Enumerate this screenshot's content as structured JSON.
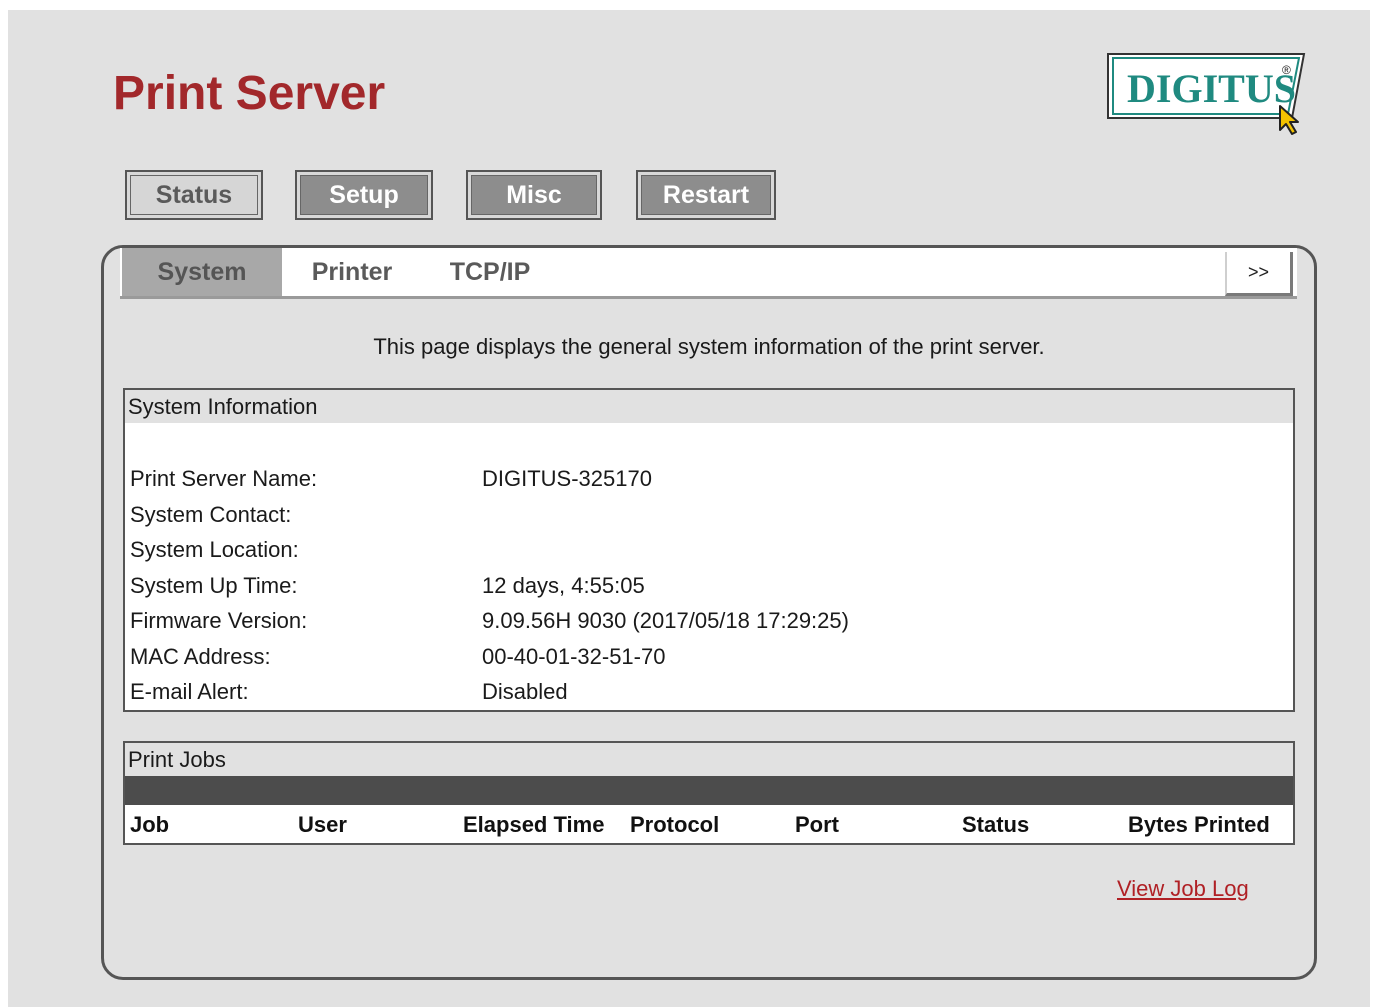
{
  "header": {
    "title": "Print Server",
    "logo_text": "DIGITUS",
    "logo_mark": "®",
    "brand_color": "#a2282b",
    "logo_color": "#1f8a80"
  },
  "main_tabs": [
    {
      "label": "Status",
      "active": true
    },
    {
      "label": "Setup",
      "active": false
    },
    {
      "label": "Misc",
      "active": false
    },
    {
      "label": "Restart",
      "active": false
    }
  ],
  "sub_tabs": [
    {
      "label": "System",
      "active": true
    },
    {
      "label": "Printer",
      "active": false
    },
    {
      "label": "TCP/IP",
      "active": false
    }
  ],
  "more_button": ">>",
  "description": "This page displays the general system information of the print server.",
  "system_info": {
    "header": "System Information",
    "rows": [
      {
        "label": "Print Server Name:",
        "value": "DIGITUS-325170"
      },
      {
        "label": "System Contact:",
        "value": ""
      },
      {
        "label": "System Location:",
        "value": ""
      },
      {
        "label": "System Up Time:",
        "value": "12 days, 4:55:05"
      },
      {
        "label": "Firmware Version:",
        "value": "9.09.56H 9030 (2017/05/18 17:29:25)"
      },
      {
        "label": "MAC Address:",
        "value": "00-40-01-32-51-70"
      },
      {
        "label": "E-mail Alert:",
        "value": "Disabled"
      }
    ]
  },
  "print_jobs": {
    "header": "Print Jobs",
    "columns": [
      "Job",
      "User",
      "Elapsed Time",
      "Protocol",
      "Port",
      "Status",
      "Bytes Printed"
    ]
  },
  "view_job_log": "View Job Log"
}
